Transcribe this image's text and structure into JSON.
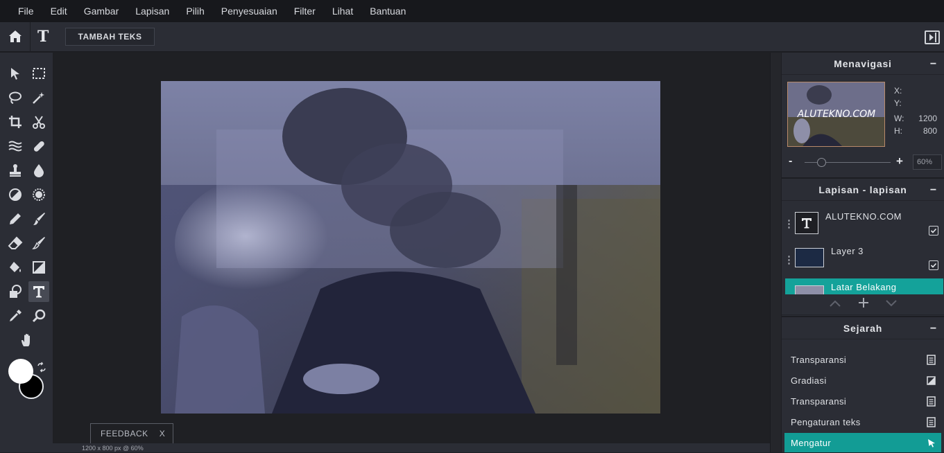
{
  "menu": [
    "File",
    "Edit",
    "Gambar",
    "Lapisan",
    "Pilih",
    "Penyesuaian",
    "Filter",
    "Lihat",
    "Bantuan"
  ],
  "options": {
    "add_text_label": "TAMBAH TEKS"
  },
  "canvas": {
    "status": "1200 x 800 px @ 60%",
    "feedback_label": "FEEDBACK",
    "feedback_close": "X"
  },
  "navigator": {
    "title": "Menavigasi",
    "minimize": "−",
    "thumb_watermark": "ALUTEKNO.COM",
    "x_label": "X:",
    "x_value": "",
    "y_label": "Y:",
    "y_value": "",
    "w_label": "W:",
    "w_value": "1200",
    "h_label": "H:",
    "h_value": "800",
    "zoom_minus": "-",
    "zoom_plus": "+",
    "zoom_value": "60%",
    "zoom_level_percent": 60
  },
  "layers": {
    "title": "Lapisan - lapisan",
    "minimize": "−",
    "items": [
      {
        "name": "ALUTEKNO.COM",
        "type": "text",
        "visible": true
      },
      {
        "name": "Layer 3",
        "type": "image",
        "visible": true
      },
      {
        "name": "Latar Belakang",
        "type": "image",
        "active": true
      }
    ]
  },
  "history": {
    "title": "Sejarah",
    "minimize": "−",
    "items": [
      {
        "label": "Transparansi",
        "icon": "document-icon"
      },
      {
        "label": "Gradiasi",
        "icon": "gradient-icon"
      },
      {
        "label": "Transparansi",
        "icon": "document-icon"
      },
      {
        "label": "Pengaturan teks",
        "icon": "document-icon"
      },
      {
        "label": "Mengatur",
        "icon": "cursor-icon",
        "active": true
      }
    ]
  },
  "colors": {
    "accent": "#14a29a",
    "foreground": "#ffffff",
    "background": "#000000"
  }
}
